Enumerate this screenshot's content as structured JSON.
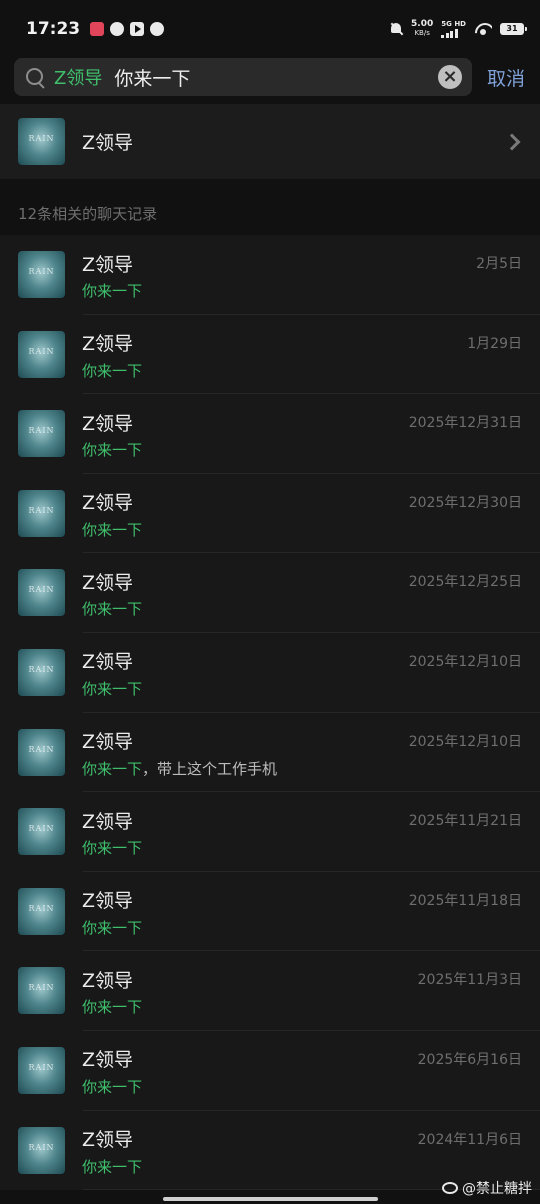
{
  "status_bar": {
    "time": "17:23",
    "net_speed_value": "5.00",
    "net_speed_unit": "KB/s",
    "network_type": "5G HD",
    "battery": "31"
  },
  "search": {
    "tag": "Z领导",
    "query": "你来一下",
    "cancel_label": "取消"
  },
  "contact": {
    "name": "Z领导",
    "avatar_text": "RAIN"
  },
  "results_header": "12条相关的聊天记录",
  "results": [
    {
      "name": "Z领导",
      "date": "2月5日",
      "highlight": "你来一下",
      "rest": ""
    },
    {
      "name": "Z领导",
      "date": "1月29日",
      "highlight": "你来一下",
      "rest": ""
    },
    {
      "name": "Z领导",
      "date": "2025年12月31日",
      "highlight": "你来一下",
      "rest": ""
    },
    {
      "name": "Z领导",
      "date": "2025年12月30日",
      "highlight": "你来一下",
      "rest": ""
    },
    {
      "name": "Z领导",
      "date": "2025年12月25日",
      "highlight": "你来一下",
      "rest": ""
    },
    {
      "name": "Z领导",
      "date": "2025年12月10日",
      "highlight": "你来一下",
      "rest": ""
    },
    {
      "name": "Z领导",
      "date": "2025年12月10日",
      "highlight": "你来一下",
      "rest": "，带上这个工作手机"
    },
    {
      "name": "Z领导",
      "date": "2025年11月21日",
      "highlight": "你来一下",
      "rest": ""
    },
    {
      "name": "Z领导",
      "date": "2025年11月18日",
      "highlight": "你来一下",
      "rest": ""
    },
    {
      "name": "Z领导",
      "date": "2025年11月3日",
      "highlight": "你来一下",
      "rest": ""
    },
    {
      "name": "Z领导",
      "date": "2025年6月16日",
      "highlight": "你来一下",
      "rest": ""
    },
    {
      "name": "Z领导",
      "date": "2024年11月6日",
      "highlight": "你来一下",
      "rest": ""
    }
  ],
  "watermark": "@禁止糖拌",
  "colors": {
    "background": "#111111",
    "highlight_green": "#3fbf6c",
    "cancel_blue": "#7fa0d6",
    "date_gray": "#6e6e6e"
  }
}
